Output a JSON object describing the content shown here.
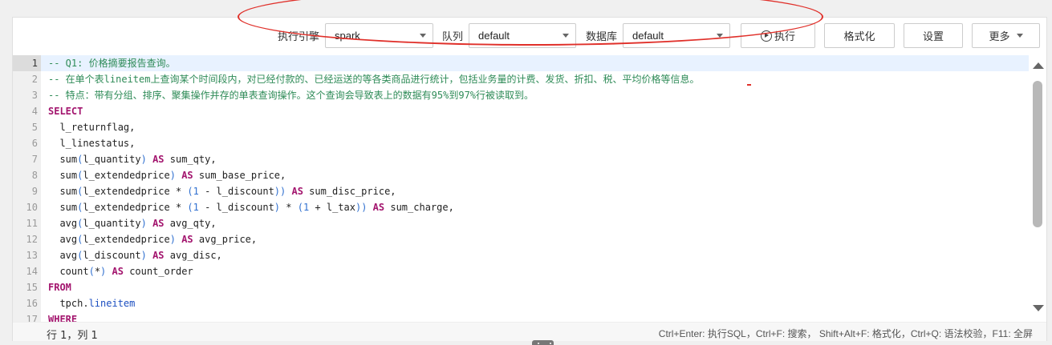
{
  "toolbar": {
    "engine_label": "执行引擎",
    "engine_value": "spark",
    "queue_label": "队列",
    "queue_value": "default",
    "db_label": "数据库",
    "db_value": "default",
    "run_label": "执行",
    "format_label": "格式化",
    "settings_label": "设置",
    "more_label": "更多",
    "highlight_color": "#e0302a"
  },
  "editor": {
    "line_numbers": [
      "1",
      "2",
      "3",
      "4",
      "5",
      "6",
      "7",
      "8",
      "9",
      "10",
      "11",
      "12",
      "13",
      "14",
      "15",
      "16",
      "17"
    ],
    "active_line": 1,
    "lines": [
      [
        {
          "t": "cm",
          "v": "-- Q1: 价格摘要报告查询。"
        }
      ],
      [
        {
          "t": "cm",
          "v": "-- 在单个表lineitem上查询某个时间段内，对已经付款的、已经运送的等各类商品进行统计，包括业务量的计费、发货、折扣、税、平均价格等信息。"
        }
      ],
      [
        {
          "t": "cm",
          "v": "-- 特点：带有分组、排序、聚集操作并存的单表查询操作。这个查询会导致表上的数据有95%到97%行被读取到。"
        }
      ],
      [
        {
          "t": "kw",
          "v": "SELECT"
        }
      ],
      [
        {
          "t": "",
          "v": "  l_returnflag,"
        }
      ],
      [
        {
          "t": "",
          "v": "  l_linestatus,"
        }
      ],
      [
        {
          "t": "",
          "v": "  sum"
        },
        {
          "t": "pn",
          "v": "("
        },
        {
          "t": "",
          "v": "l_quantity"
        },
        {
          "t": "pn",
          "v": ")"
        },
        {
          "t": "",
          "v": " "
        },
        {
          "t": "kw",
          "v": "AS"
        },
        {
          "t": "",
          "v": " sum_qty,"
        }
      ],
      [
        {
          "t": "",
          "v": "  sum"
        },
        {
          "t": "pn",
          "v": "("
        },
        {
          "t": "",
          "v": "l_extendedprice"
        },
        {
          "t": "pn",
          "v": ")"
        },
        {
          "t": "",
          "v": " "
        },
        {
          "t": "kw",
          "v": "AS"
        },
        {
          "t": "",
          "v": " sum_base_price,"
        }
      ],
      [
        {
          "t": "",
          "v": "  sum"
        },
        {
          "t": "pn",
          "v": "("
        },
        {
          "t": "",
          "v": "l_extendedprice * "
        },
        {
          "t": "pn",
          "v": "("
        },
        {
          "t": "nm",
          "v": "1"
        },
        {
          "t": "",
          "v": " - l_discount"
        },
        {
          "t": "pn",
          "v": "))"
        },
        {
          "t": "",
          "v": " "
        },
        {
          "t": "kw",
          "v": "AS"
        },
        {
          "t": "",
          "v": " sum_disc_price,"
        }
      ],
      [
        {
          "t": "",
          "v": "  sum"
        },
        {
          "t": "pn",
          "v": "("
        },
        {
          "t": "",
          "v": "l_extendedprice * "
        },
        {
          "t": "pn",
          "v": "("
        },
        {
          "t": "nm",
          "v": "1"
        },
        {
          "t": "",
          "v": " - l_discount"
        },
        {
          "t": "pn",
          "v": ")"
        },
        {
          "t": "",
          "v": " * "
        },
        {
          "t": "pn",
          "v": "("
        },
        {
          "t": "nm",
          "v": "1"
        },
        {
          "t": "",
          "v": " + l_tax"
        },
        {
          "t": "pn",
          "v": "))"
        },
        {
          "t": "",
          "v": " "
        },
        {
          "t": "kw",
          "v": "AS"
        },
        {
          "t": "",
          "v": " sum_charge,"
        }
      ],
      [
        {
          "t": "",
          "v": "  avg"
        },
        {
          "t": "pn",
          "v": "("
        },
        {
          "t": "",
          "v": "l_quantity"
        },
        {
          "t": "pn",
          "v": ")"
        },
        {
          "t": "",
          "v": " "
        },
        {
          "t": "kw",
          "v": "AS"
        },
        {
          "t": "",
          "v": " avg_qty,"
        }
      ],
      [
        {
          "t": "",
          "v": "  avg"
        },
        {
          "t": "pn",
          "v": "("
        },
        {
          "t": "",
          "v": "l_extendedprice"
        },
        {
          "t": "pn",
          "v": ")"
        },
        {
          "t": "",
          "v": " "
        },
        {
          "t": "kw",
          "v": "AS"
        },
        {
          "t": "",
          "v": " avg_price,"
        }
      ],
      [
        {
          "t": "",
          "v": "  avg"
        },
        {
          "t": "pn",
          "v": "("
        },
        {
          "t": "",
          "v": "l_discount"
        },
        {
          "t": "pn",
          "v": ")"
        },
        {
          "t": "",
          "v": " "
        },
        {
          "t": "kw",
          "v": "AS"
        },
        {
          "t": "",
          "v": " avg_disc,"
        }
      ],
      [
        {
          "t": "",
          "v": "  count"
        },
        {
          "t": "pn",
          "v": "("
        },
        {
          "t": "",
          "v": "*"
        },
        {
          "t": "pn",
          "v": ")"
        },
        {
          "t": "",
          "v": " "
        },
        {
          "t": "kw",
          "v": "AS"
        },
        {
          "t": "",
          "v": " count_order"
        }
      ],
      [
        {
          "t": "kw",
          "v": "FROM"
        }
      ],
      [
        {
          "t": "",
          "v": "  tpch."
        },
        {
          "t": "tb",
          "v": "lineitem"
        }
      ],
      [
        {
          "t": "kw",
          "v": "WHERE"
        }
      ]
    ]
  },
  "status": {
    "cursor": "行 1，列 1",
    "shortcuts": "Ctrl+Enter: 执行SQL，Ctrl+F: 搜索， Shift+Alt+F: 格式化，Ctrl+Q: 语法校验，F11: 全屏"
  }
}
